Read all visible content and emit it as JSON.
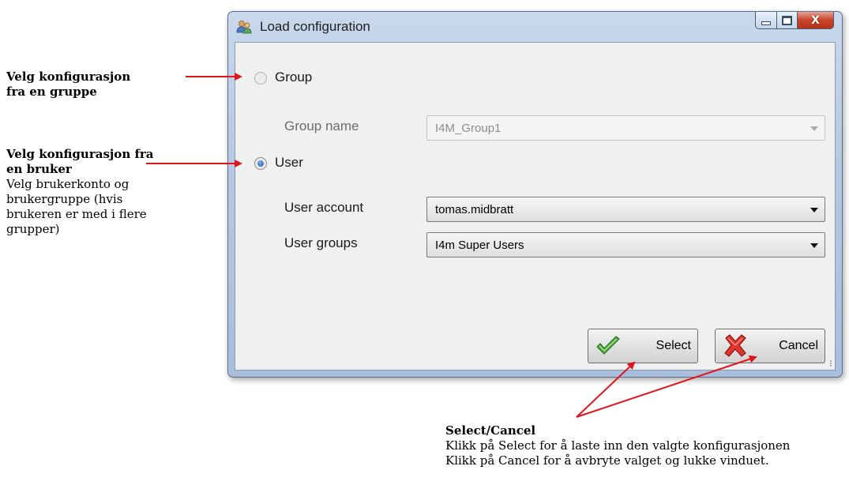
{
  "window": {
    "title": "Load configuration",
    "close_glyph": "X"
  },
  "group_option": {
    "label": "Group",
    "checked": false,
    "field_label": "Group name",
    "field_value": "I4M_Group1"
  },
  "user_option": {
    "label": "User",
    "checked": true,
    "account_label": "User account",
    "account_value": "tomas.midbratt",
    "groups_label": "User groups",
    "groups_value": "I4m Super Users"
  },
  "buttons": {
    "select_label": "Select",
    "cancel_label": "Cancel"
  },
  "annotations": {
    "group_title_line1": "Velg konfigurasjon",
    "group_title_line2": "fra en gruppe",
    "user_title_line1": "Velg konfigurasjon fra",
    "user_title_line2": "en bruker",
    "user_desc_line1": "Velg brukerkonto og",
    "user_desc_line2": "brukergruppe (hvis",
    "user_desc_line3": "brukeren er med i flere",
    "user_desc_line4": "grupper)",
    "select_title": "Select/Cancel",
    "select_desc_line1": "Klikk på Select for å laste inn den valgte konfigurasjonen",
    "select_desc_line2": "Klikk på Cancel for å avbryte valget og lukke vinduet."
  },
  "icons": {
    "app": "users-icon",
    "select": "checkmark-icon",
    "cancel": "x-icon"
  },
  "colors": {
    "arrow": "#e0141b",
    "radio_checked": "#1c4fa0",
    "close_button": "#c8452a"
  }
}
